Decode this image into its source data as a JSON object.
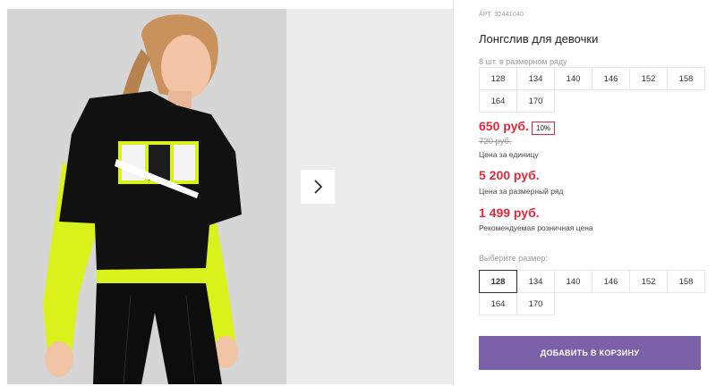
{
  "product": {
    "article": "АРТ. 32441040",
    "title": "Лонгслив для девочки"
  },
  "pack": {
    "label": "8 шт. в размерном ряду",
    "sizes": [
      "128",
      "134",
      "140",
      "146",
      "152",
      "158",
      "164",
      "170"
    ]
  },
  "pricing": {
    "price": "650 руб.",
    "discount": "10%",
    "old_price": "720 руб.",
    "unit_caption": "Цена за единицу",
    "pack_price": "5 200 руб.",
    "pack_caption": "Цена за размерный ряд",
    "rrp_price": "1 499 руб.",
    "rrp_caption": "Рекомендуемая розничная цена"
  },
  "size_select": {
    "label": "Выберите размер:",
    "sizes": [
      "128",
      "134",
      "140",
      "146",
      "152",
      "158",
      "164",
      "170"
    ],
    "selected": "128"
  },
  "cart": {
    "button_label": "ДОБАВИТЬ В КОРЗИНУ"
  },
  "colors": {
    "accent_purple": "#7b62a8",
    "price_red": "#e0293b",
    "neon_yellow": "#d9f21c"
  },
  "icons": {
    "next": "chevron-right-icon"
  }
}
